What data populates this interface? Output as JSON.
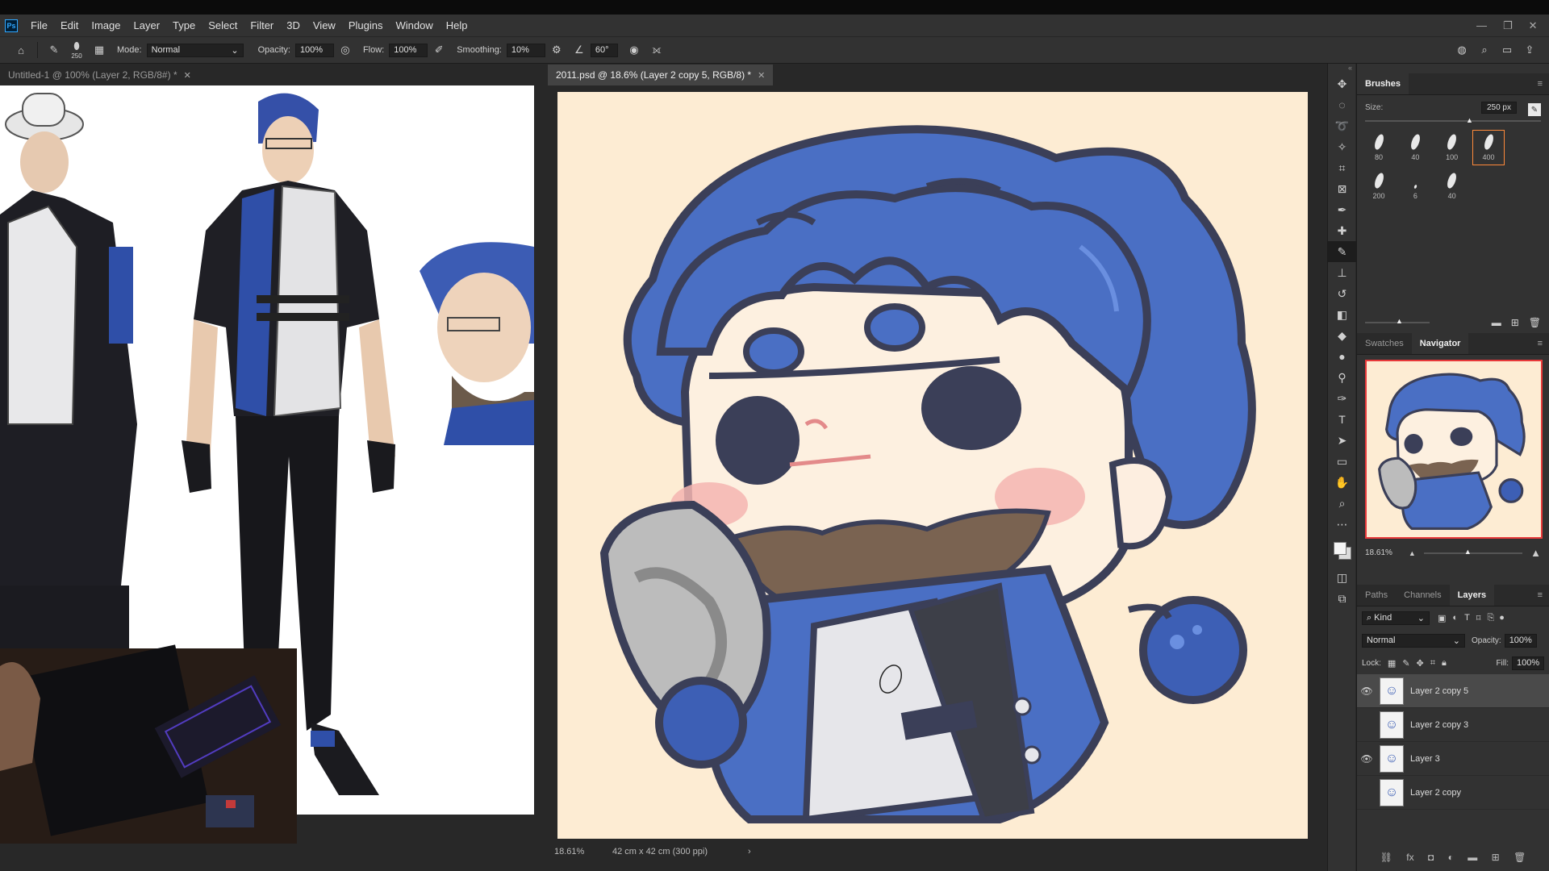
{
  "app": {
    "logo": "Ps",
    "menu": [
      "File",
      "Edit",
      "Image",
      "Layer",
      "Type",
      "Select",
      "Filter",
      "3D",
      "View",
      "Plugins",
      "Window",
      "Help"
    ],
    "window_controls": [
      "—",
      "❐",
      "✕"
    ]
  },
  "options": {
    "brush_size": "250",
    "mode_label": "Mode:",
    "mode_value": "Normal",
    "opacity_label": "Opacity:",
    "opacity_value": "100%",
    "flow_label": "Flow:",
    "flow_value": "100%",
    "smoothing_label": "Smoothing:",
    "smoothing_value": "10%",
    "angle_value": "60°"
  },
  "documents": {
    "left_tab": "Untitled-1 @ 100% (Layer 2, RGB/8#) *",
    "right_tab": "2011.psd @ 18.6% (Layer 2 copy 5, RGB/8) *",
    "right_zoom": "18.61%",
    "right_size": "42 cm x 42 cm (300 ppi)"
  },
  "brushes_panel": {
    "title": "Brushes",
    "size_label": "Size:",
    "size_value": "250 px",
    "presets": [
      "80",
      "40",
      "100",
      "400",
      "200",
      "6",
      "40"
    ],
    "selected_index": 3
  },
  "navigator_panel": {
    "tabs": [
      "Swatches",
      "Navigator"
    ],
    "active": "Navigator",
    "zoom": "18.61%"
  },
  "layers_panel": {
    "tabs": [
      "Paths",
      "Channels",
      "Layers"
    ],
    "active": "Layers",
    "kind_label": "Kind",
    "blend_mode": "Normal",
    "opacity_label": "Opacity:",
    "opacity_value": "100%",
    "lock_label": "Lock:",
    "fill_label": "Fill:",
    "fill_value": "100%",
    "layers": [
      {
        "name": "Layer 2 copy 5",
        "visible": true,
        "selected": true
      },
      {
        "name": "Layer 2 copy 3",
        "visible": false,
        "selected": false
      },
      {
        "name": "Layer 3",
        "visible": true,
        "selected": false
      },
      {
        "name": "Layer 2 copy",
        "visible": false,
        "selected": false
      }
    ]
  },
  "colors": {
    "canvas_bg": "#fdecd3",
    "hair_blue": "#4a6fc4",
    "outline": "#3b3f58",
    "ui_bg": "#323232",
    "accent_selected": "#ff8a3a"
  }
}
